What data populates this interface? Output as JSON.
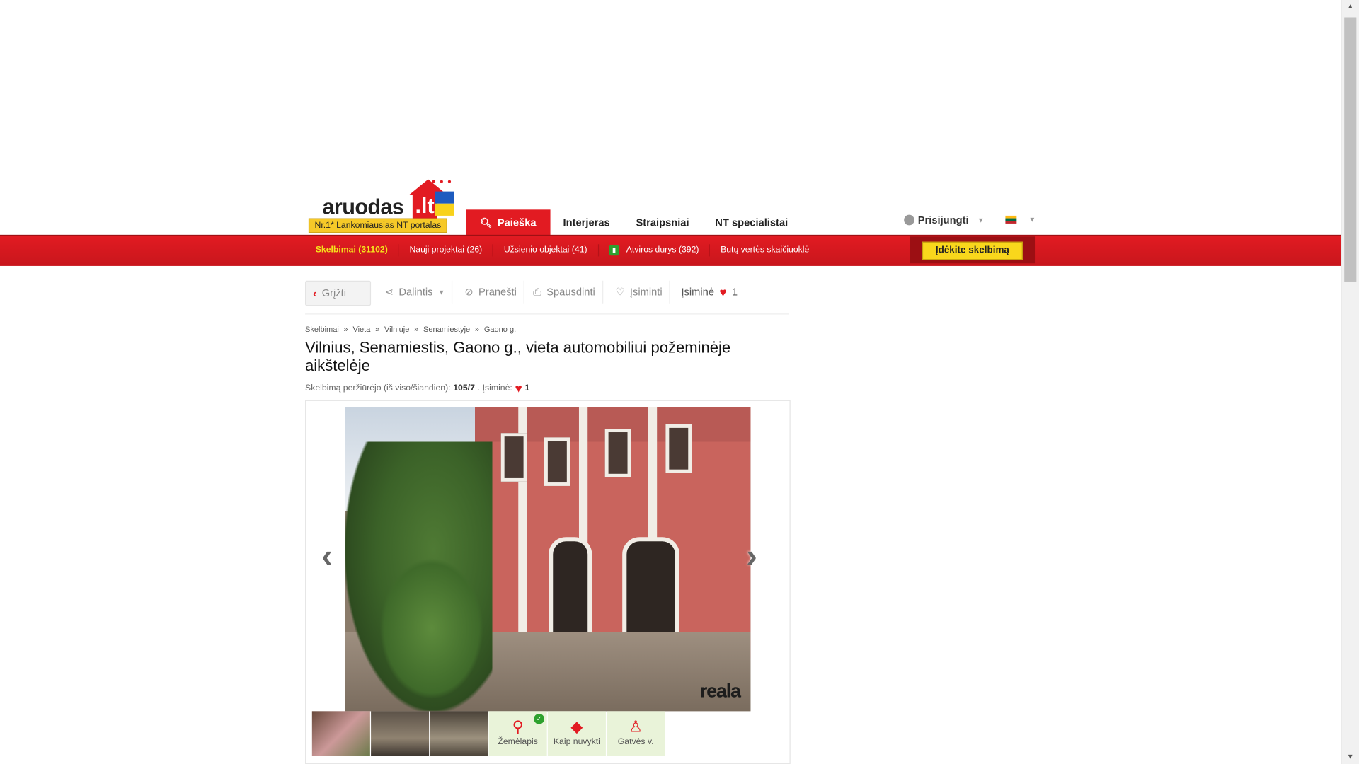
{
  "header": {
    "logo_text": "aruodas",
    "logo_domain": ".lt",
    "logo_tagline": "Nr.1* Lankomiausias NT portalas",
    "nav_tabs": [
      {
        "label": "Paieška",
        "active": true
      },
      {
        "label": "Interjeras",
        "active": false
      },
      {
        "label": "Straipsniai",
        "active": false
      },
      {
        "label": "NT specialistai",
        "active": false
      }
    ],
    "login_label": "Prisijungti",
    "language": "lt"
  },
  "subnav": {
    "items": [
      {
        "label": "Skelbimai (31102)"
      },
      {
        "label": "Nauji projektai (26)"
      },
      {
        "label": "Užsienio objektai (41)"
      },
      {
        "label": "Atviros durys (392)"
      },
      {
        "label": "Butų vertės skaičiuoklė"
      }
    ],
    "post_button": "Įdėkite skelbimą"
  },
  "toolbar": {
    "back": "Grįžti",
    "share": "Dalintis",
    "report": "Pranešti",
    "print": "Spausdinti",
    "remember": "Įsiminti",
    "saved_label": "Įsiminė",
    "saved_count": "1"
  },
  "breadcrumb": [
    "Skelbimai",
    "»",
    "Vieta",
    "»",
    "Vilniuje",
    "»",
    "Senamiestyje",
    "»",
    "Gaono g."
  ],
  "listing": {
    "title": "Vilnius, Senamiestis, Gaono g., vieta automobiliui požeminėje aikštelėje",
    "views_label": "Skelbimą peržiūrėjo (iš viso/šiandien):",
    "views_value": "105/7",
    "saved_label": "Įsiminė:",
    "saved_value": "1"
  },
  "gallery": {
    "watermark": "reala",
    "tools": [
      {
        "label": "Žemėlapis",
        "icon": "map-pin-icon"
      },
      {
        "label": "Kaip nuvykti",
        "icon": "directions-icon"
      },
      {
        "label": "Gatvės v.",
        "icon": "street-view-icon"
      }
    ]
  },
  "colors": {
    "brand_red": "#e21b22",
    "accent_yellow": "#f9d71c"
  }
}
